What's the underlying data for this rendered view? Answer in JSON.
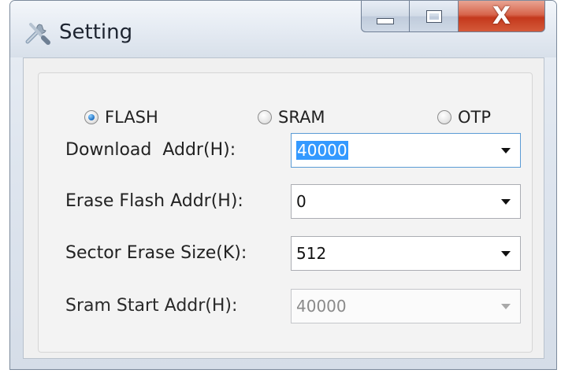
{
  "window": {
    "title": "Setting",
    "icon": "tools-icon",
    "close_glyph": "X"
  },
  "memory_type": {
    "selected": "FLASH",
    "options": [
      {
        "label": "FLASH",
        "checked": true
      },
      {
        "label": "SRAM",
        "checked": false
      },
      {
        "label": "OTP",
        "checked": false
      }
    ]
  },
  "fields": [
    {
      "label": "Download  Addr(H):",
      "value": "40000",
      "enabled": true,
      "value_selected": true
    },
    {
      "label": "Erase Flash Addr(H):",
      "value": "0",
      "enabled": true,
      "value_selected": false
    },
    {
      "label": "Sector Erase Size(K):",
      "value": "512",
      "enabled": true,
      "value_selected": false
    },
    {
      "label": "Sram Start Addr(H):",
      "value": "40000",
      "enabled": false,
      "value_selected": false
    }
  ],
  "colors": {
    "selection_highlight": "#3399ff",
    "close_button": "#c4381c",
    "radio_dot": "#1d6fc2"
  }
}
